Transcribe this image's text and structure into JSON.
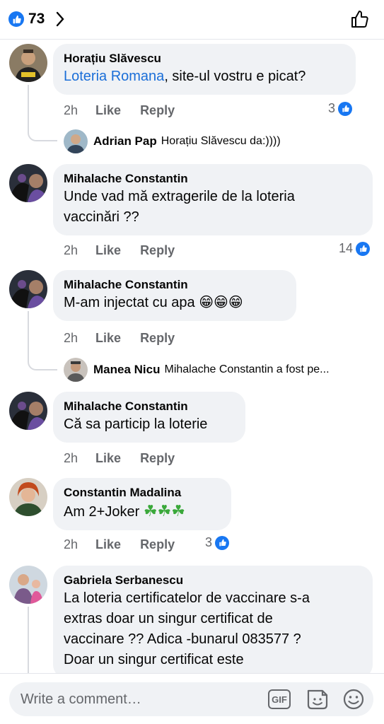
{
  "header": {
    "reaction_count": "73",
    "reaction_icon": "like-icon",
    "like_button_icon": "thumbs-up-outline-icon"
  },
  "comments": [
    {
      "author": "Horațiu Slăvescu",
      "mention": "Loteria Romana",
      "text": ", site-ul vostru e picat?",
      "time": "2h",
      "like": "Like",
      "reply": "Reply",
      "reactions": "3",
      "reply_preview": {
        "author": "Adrian Pap",
        "text": "Horațiu Slăvescu da:))))"
      }
    },
    {
      "author": "Mihalache Constantin",
      "text_line1": "Unde vad mă extragerile de la loteria",
      "text_line2": "vaccinări ??",
      "time": "2h",
      "like": "Like",
      "reply": "Reply",
      "reactions": "14"
    },
    {
      "author": "Mihalache Constantin",
      "text": "M-am injectat cu apa 😁😁😁",
      "time": "2h",
      "like": "Like",
      "reply": "Reply",
      "reply_preview": {
        "author": "Manea Nicu",
        "text": "Mihalache Constantin a fost pe..."
      }
    },
    {
      "author": "Mihalache Constantin",
      "text": "Că sa particip la loterie",
      "time": "2h",
      "like": "Like",
      "reply": "Reply"
    },
    {
      "author": "Constantin Madalina",
      "text": "Am 2+Joker",
      "emoji": "☘☘☘",
      "time": "2h",
      "like": "Like",
      "reply": "Reply",
      "reactions": "3"
    },
    {
      "author": "Gabriela Serbanescu",
      "text_line1": "La loteria certificatelor de vaccinare s-a",
      "text_line2": "extras doar un singur certificat de",
      "text_line3": "vaccinare ?? Adica -bunarul 083577 ?",
      "text_line4": "Doar un singur certificat este"
    }
  ],
  "composer": {
    "placeholder": "Write a comment…",
    "gif_label": "GIF",
    "sticker_icon": "sticker-icon",
    "emoji_icon": "emoji-icon"
  },
  "colors": {
    "accent": "#1877f2",
    "bubble": "#f0f2f5",
    "muted": "#65676b",
    "mention": "#1a6ed8"
  }
}
